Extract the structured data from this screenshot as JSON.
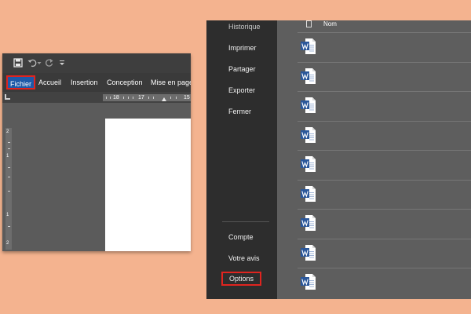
{
  "word_window": {
    "ribbon_tabs": [
      {
        "label": "Fichier"
      },
      {
        "label": "Accueil"
      },
      {
        "label": "Insertion"
      },
      {
        "label": "Conception"
      },
      {
        "label": "Mise en page"
      }
    ],
    "ruler_numbers": [
      "18",
      "17",
      "15"
    ],
    "vertical_ruler_numbers": [
      "2",
      "1",
      "1",
      "2"
    ]
  },
  "backstage": {
    "menu_items": [
      {
        "label": "Historique"
      },
      {
        "label": "Imprimer"
      },
      {
        "label": "Partager"
      },
      {
        "label": "Exporter"
      },
      {
        "label": "Fermer"
      }
    ],
    "bottom_items": [
      {
        "label": "Compte"
      },
      {
        "label": "Votre avis"
      },
      {
        "label": "Options"
      }
    ],
    "column_header": "Nom",
    "file_count": 9
  },
  "colors": {
    "background": "#f4b38f",
    "highlight": "#e0241f",
    "word_blue": "#2b579a"
  }
}
